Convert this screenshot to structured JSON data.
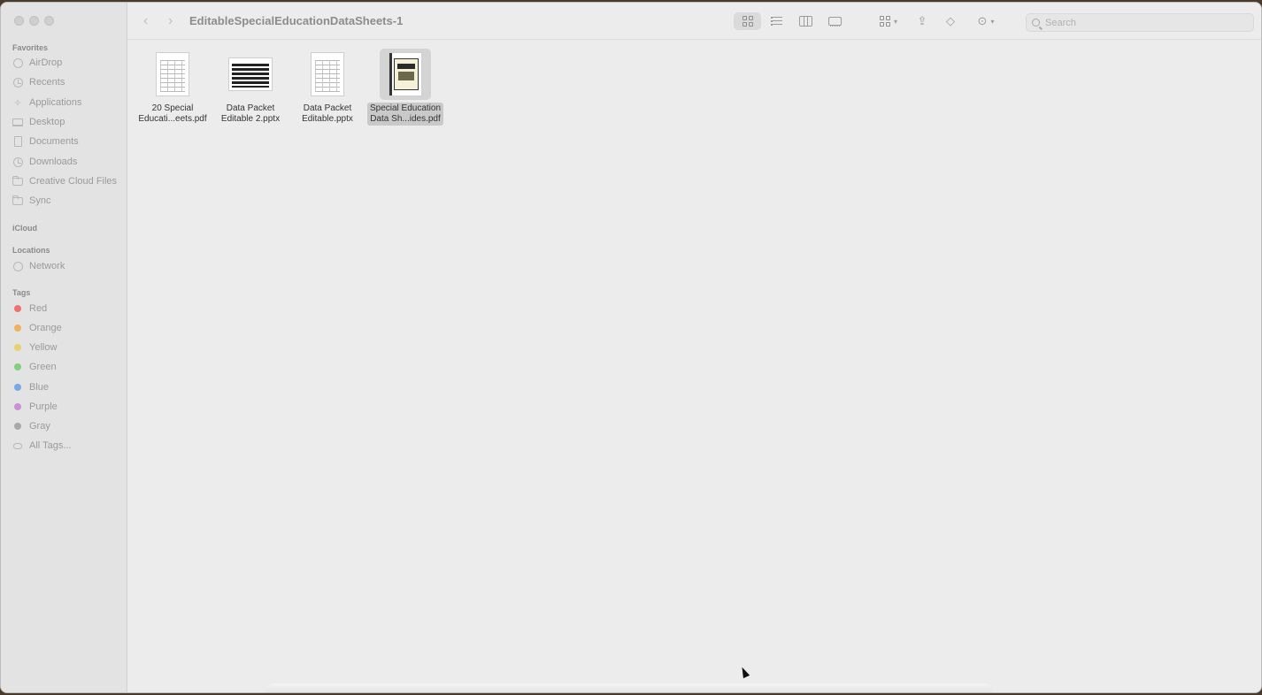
{
  "window": {
    "title": "EditableSpecialEducationDataSheets-1"
  },
  "sidebar": {
    "favorites_label": "Favorites",
    "favorites": [
      {
        "label": "AirDrop",
        "icon": "airdrop-icon"
      },
      {
        "label": "Recents",
        "icon": "clock-icon"
      },
      {
        "label": "Applications",
        "icon": "applications-icon"
      },
      {
        "label": "Desktop",
        "icon": "desktop-icon"
      },
      {
        "label": "Documents",
        "icon": "document-icon"
      },
      {
        "label": "Downloads",
        "icon": "download-icon"
      },
      {
        "label": "Creative Cloud Files",
        "icon": "folder-icon"
      },
      {
        "label": "Sync",
        "icon": "folder-icon"
      }
    ],
    "icloud_label": "iCloud",
    "locations_label": "Locations",
    "locations": [
      {
        "label": "Network",
        "icon": "globe-icon"
      }
    ],
    "tags_label": "Tags",
    "tags": [
      {
        "label": "Red",
        "color": "#f07070"
      },
      {
        "label": "Orange",
        "color": "#f0b060"
      },
      {
        "label": "Yellow",
        "color": "#e8d070"
      },
      {
        "label": "Green",
        "color": "#80d080"
      },
      {
        "label": "Blue",
        "color": "#7aa8e8"
      },
      {
        "label": "Purple",
        "color": "#c890d8"
      },
      {
        "label": "Gray",
        "color": "#a8a8a8"
      },
      {
        "label": "All Tags..."
      }
    ]
  },
  "toolbar": {
    "search_placeholder": "Search"
  },
  "files": [
    {
      "line1": "20 Special",
      "line2": "Educati...eets.pdf",
      "kind": "pdf-grid",
      "selected": false
    },
    {
      "line1": "Data Packet",
      "line2": "Editable 2.pptx",
      "kind": "pptx-bars",
      "selected": false
    },
    {
      "line1": "Data Packet",
      "line2": "Editable.pptx",
      "kind": "pptx-grid",
      "selected": false
    },
    {
      "line1": "Special Education",
      "line2": "Data Sh...ides.pdf",
      "kind": "pdf-cover",
      "selected": true
    }
  ]
}
